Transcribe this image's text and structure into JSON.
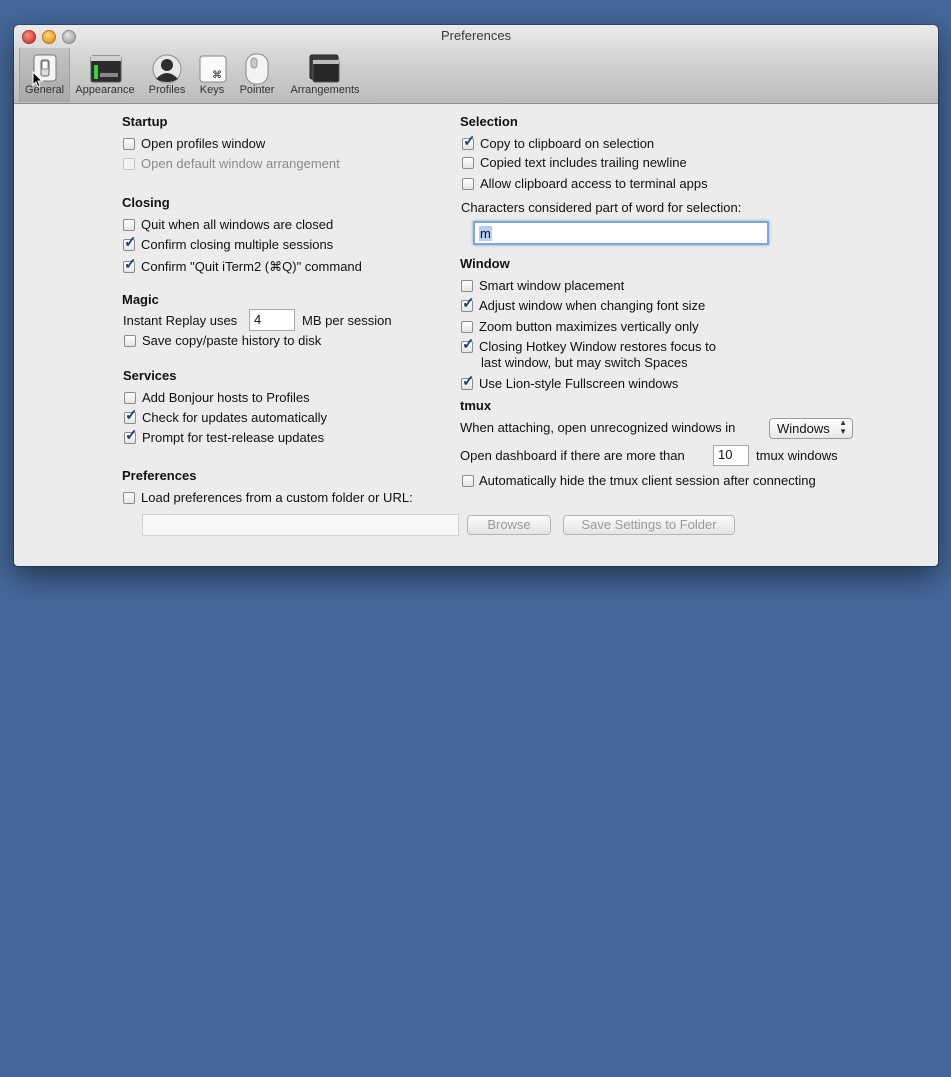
{
  "window": {
    "title": "Preferences"
  },
  "toolbar": {
    "items": [
      {
        "label": "General"
      },
      {
        "label": "Appearance"
      },
      {
        "label": "Profiles"
      },
      {
        "label": "Keys"
      },
      {
        "label": "Pointer"
      },
      {
        "label": "Arrangements"
      }
    ],
    "keys_glyph": "⌘"
  },
  "startup": {
    "heading": "Startup",
    "open_profiles": "Open profiles window",
    "open_default_arrangement": "Open default window arrangement"
  },
  "closing": {
    "heading": "Closing",
    "quit_when_closed": "Quit when all windows are closed",
    "confirm_multiple": "Confirm closing multiple sessions",
    "confirm_quit": "Confirm \"Quit iTerm2 (⌘Q)\" command"
  },
  "magic": {
    "heading": "Magic",
    "instant_replay_label": "Instant Replay uses",
    "instant_replay_value": "4",
    "instant_replay_unit": "MB per session",
    "save_history": "Save copy/paste history to disk"
  },
  "services": {
    "heading": "Services",
    "bonjour": "Add Bonjour hosts to Profiles",
    "check_updates": "Check for updates automatically",
    "test_release": "Prompt for test-release updates"
  },
  "preferences": {
    "heading": "Preferences",
    "load_custom": "Load preferences from a custom folder or URL:",
    "path_value": "",
    "browse_label": "Browse",
    "save_folder_label": "Save Settings to Folder"
  },
  "selection": {
    "heading": "Selection",
    "copy_on_select": "Copy to clipboard on selection",
    "trailing_newline": "Copied text includes trailing newline",
    "clipboard_access": "Allow clipboard access to terminal apps",
    "word_chars_label": "Characters considered part of word for selection:",
    "word_chars_value": "m"
  },
  "window_section": {
    "heading": "Window",
    "smart_placement": "Smart window placement",
    "adjust_font": "Adjust window when changing font size",
    "zoom_vertical": "Zoom button maximizes vertically only",
    "hotkey_line1": "Closing Hotkey Window restores focus to",
    "hotkey_line2": "last window, but may switch Spaces",
    "lion_fullscreen": "Use Lion-style Fullscreen windows"
  },
  "tmux": {
    "heading": "tmux",
    "attach_label": "When attaching, open unrecognized windows in",
    "attach_value": "Windows",
    "dashboard_label": "Open dashboard if there are more than",
    "dashboard_value": "10",
    "dashboard_unit": "tmux windows",
    "auto_hide": "Automatically hide the tmux client session after connecting"
  },
  "checkmark_glyph": "✓"
}
